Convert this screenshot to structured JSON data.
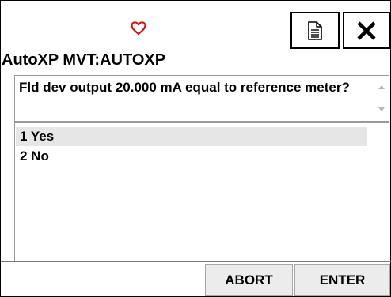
{
  "header": {
    "status_icon": "heart-outline-icon",
    "status_icon_color": "#d01414",
    "title": "AutoXP MVT:AUTOXP",
    "toolbar": {
      "document_icon": "document-icon",
      "close_icon": "close-icon"
    }
  },
  "prompt": {
    "text": "Fld dev output 20.000 mA equal to reference meter?"
  },
  "options": [
    {
      "label": "1 Yes",
      "selected": true
    },
    {
      "label": "2 No",
      "selected": false
    }
  ],
  "actions": {
    "abort_label": "ABORT",
    "enter_label": "ENTER"
  }
}
